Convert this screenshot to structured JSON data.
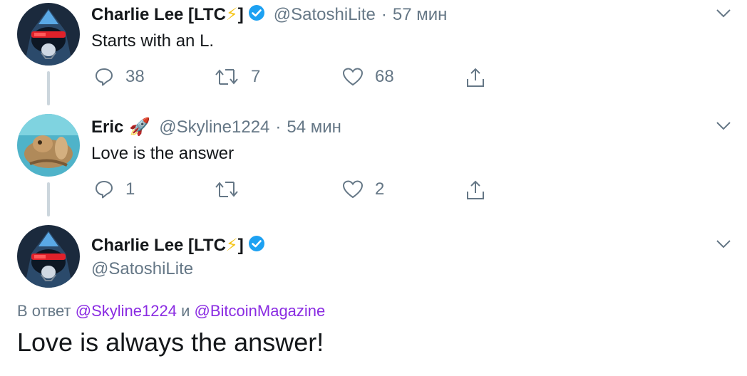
{
  "tweet1": {
    "name_prefix": "Charlie Lee [LTC",
    "name_bolt": "⚡",
    "name_suffix": "]",
    "handle": "@SatoshiLite",
    "sep": "·",
    "time": "57 мин",
    "text": "Starts with an L.",
    "replies": "38",
    "retweets": "7",
    "likes": "68"
  },
  "tweet2": {
    "name": "Eric",
    "rocket": "🚀",
    "handle": "@Skyline1224",
    "sep": "·",
    "time": "54 мин",
    "text": "Love is the answer",
    "replies": "1",
    "retweets": "",
    "likes": "2"
  },
  "tweet3": {
    "name_prefix": "Charlie Lee [LTC",
    "name_bolt": "⚡",
    "name_suffix": "]",
    "handle": "@SatoshiLite",
    "reply_prefix": "В ответ",
    "mention1": "@Skyline1224",
    "reply_and": "и",
    "mention2": "@BitcoinMagazine",
    "text": "Love is always the answer!"
  },
  "colors": {
    "verified": "#1da1f2",
    "muted": "#657786",
    "mention": "#8a2be2"
  }
}
